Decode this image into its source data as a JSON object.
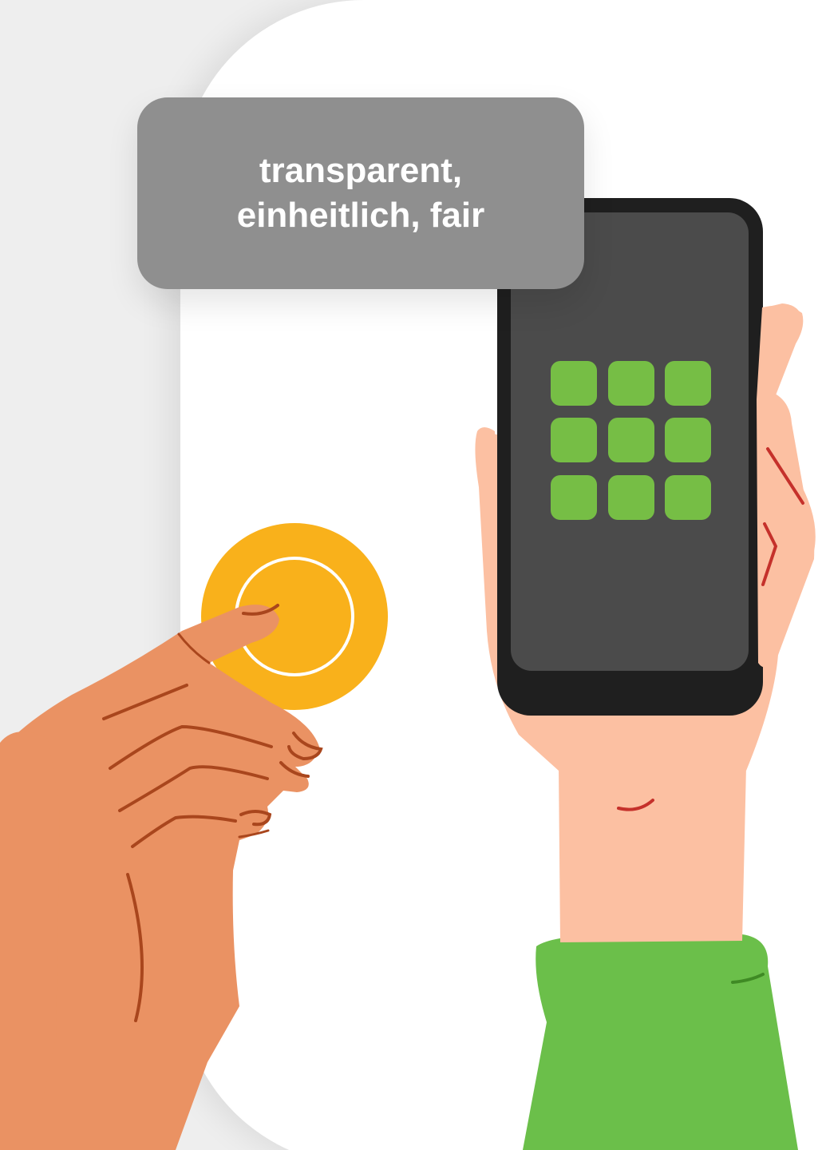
{
  "label": {
    "line1": "transparent,",
    "line2": "einheitlich, fair"
  },
  "icons": {
    "app_grid": "app-grid-icon",
    "coin": "coin-icon"
  },
  "colors": {
    "background": "#eeeeee",
    "card": "#ffffff",
    "label_box": "#8f8f8f",
    "label_text": "#ffffff",
    "phone_body": "#1f1f1f",
    "phone_screen": "#4b4b4b",
    "app_tile": "#76be45",
    "coin": "#f9b11b",
    "hand_dark": "#ea9263",
    "hand_light": "#fcc0a2",
    "sleeve": "#6bbf4a",
    "line_brown": "#a9461d",
    "line_red": "#c5312b"
  }
}
